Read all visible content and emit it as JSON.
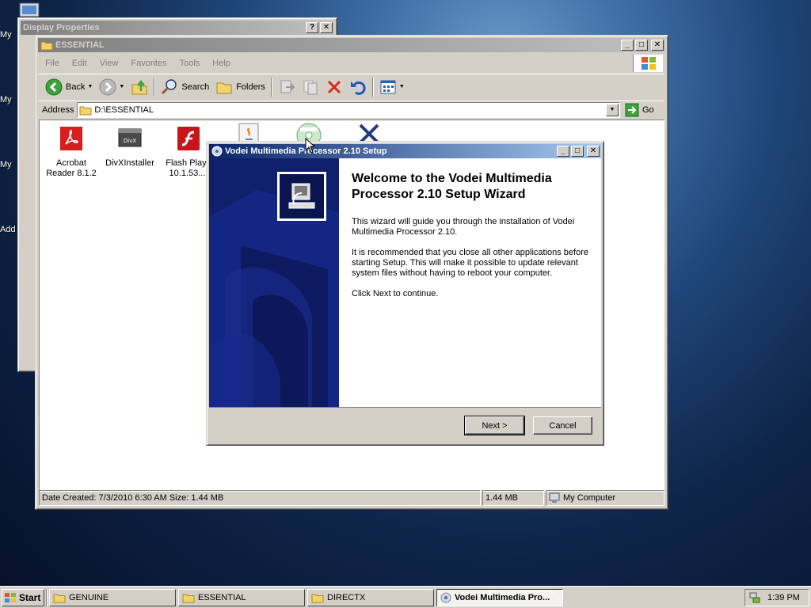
{
  "desktop": {
    "icon_labels": [
      "My",
      "My",
      "My",
      "Add"
    ]
  },
  "display_properties": {
    "title": "Display Properties"
  },
  "explorer": {
    "title": "ESSENTIAL",
    "menu": [
      "File",
      "Edit",
      "View",
      "Favorites",
      "Tools",
      "Help"
    ],
    "toolbar": {
      "back": "Back",
      "search": "Search",
      "folders": "Folders"
    },
    "address": {
      "label": "Address",
      "value": "D:\\ESSENTIAL",
      "go": "Go"
    },
    "files": [
      {
        "label": "Acrobat Reader 8.1.2"
      },
      {
        "label": "DivXInstaller"
      },
      {
        "label": "Flash Playe 10.1.53...."
      }
    ],
    "status": {
      "info": "Date Created: 7/3/2010 6:30 AM Size: 1.44 MB",
      "size": "1.44 MB",
      "zone": "My Computer"
    }
  },
  "setup": {
    "title": "Vodei Multimedia Processor 2.10 Setup",
    "heading": "Welcome to the Vodei Multimedia Processor 2.10 Setup Wizard",
    "para1": "This wizard will guide you through the installation of Vodei Multimedia Processor 2.10.",
    "para2": "It is recommended that you close all other applications before starting Setup. This will make it possible to update relevant system files without having to reboot your computer.",
    "para3": "Click Next to continue.",
    "next": "Next >",
    "cancel": "Cancel"
  },
  "taskbar": {
    "start": "Start",
    "tasks": [
      {
        "label": "GENUINE"
      },
      {
        "label": "ESSENTIAL"
      },
      {
        "label": "DIRECTX"
      },
      {
        "label": "Vodei Multimedia Pro..."
      }
    ],
    "clock": "1:39 PM"
  },
  "colors": {
    "titlebar_active": "#0a246a",
    "banner": "#0f1f6e",
    "face": "#d4d0c8"
  }
}
